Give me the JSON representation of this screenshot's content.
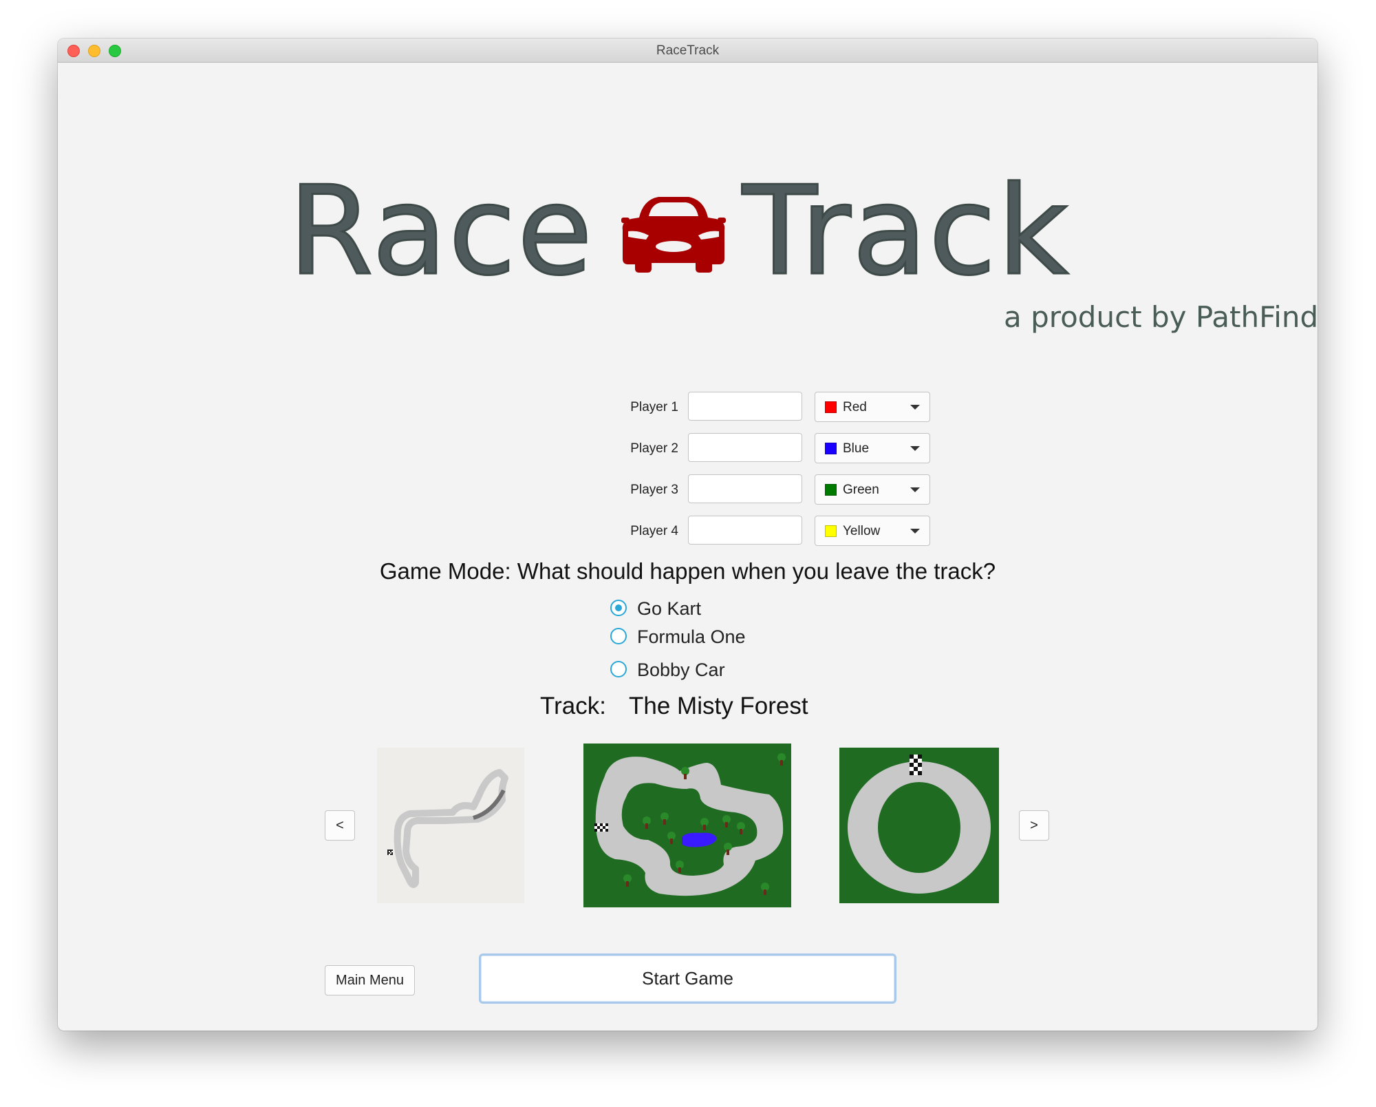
{
  "window": {
    "title": "RaceTrack"
  },
  "logo": {
    "word_left": "Race",
    "word_right": "Track",
    "tagline": "a product by PathFinder"
  },
  "players": [
    {
      "label": "Player 1",
      "name_value": "",
      "color_label": "Red",
      "color_hex": "#ff0000"
    },
    {
      "label": "Player 2",
      "name_value": "",
      "color_label": "Blue",
      "color_hex": "#1a00ff"
    },
    {
      "label": "Player 3",
      "name_value": "",
      "color_label": "Green",
      "color_hex": "#007a00"
    },
    {
      "label": "Player 4",
      "name_value": "",
      "color_label": "Yellow",
      "color_hex": "#ffff00"
    }
  ],
  "game_mode": {
    "question": "Game Mode: What should happen when you leave the track?",
    "options": [
      {
        "label": "Go Kart",
        "selected": true
      },
      {
        "label": "Formula One",
        "selected": false
      },
      {
        "label": "Bobby Car",
        "selected": false
      }
    ]
  },
  "track": {
    "label": "Track:",
    "name": "The Misty Forest",
    "prev_label": "<",
    "next_label": ">"
  },
  "buttons": {
    "main_menu": "Main Menu",
    "start_game": "Start Game"
  },
  "colors": {
    "accent": "#2aa7d6",
    "logo_text": "#4f5a5c",
    "car_red": "#a80000",
    "grass": "#1e6b24",
    "track_grey": "#c8c8c8",
    "water": "#3a1aff"
  }
}
